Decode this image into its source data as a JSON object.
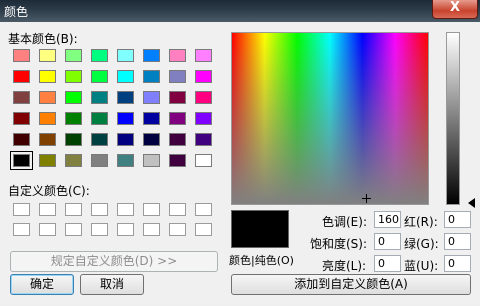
{
  "window": {
    "title": "颜色",
    "close_label": "X"
  },
  "basic_colors_label": "基本颜色(B):",
  "custom_colors_label": "自定义颜色(C):",
  "basic_colors": [
    [
      "#ff8080",
      "#ffff80",
      "#80ff80",
      "#00ff80",
      "#80ffff",
      "#0080ff",
      "#ff80c0",
      "#ff80ff"
    ],
    [
      "#ff0000",
      "#ffff00",
      "#80ff00",
      "#00ff40",
      "#00ffff",
      "#0080c0",
      "#8080c0",
      "#ff00ff"
    ],
    [
      "#804040",
      "#ff8040",
      "#00ff00",
      "#008080",
      "#004080",
      "#8080ff",
      "#800040",
      "#ff0080"
    ],
    [
      "#800000",
      "#ff8000",
      "#008000",
      "#008040",
      "#0000ff",
      "#0000a0",
      "#800080",
      "#8000ff"
    ],
    [
      "#400000",
      "#804000",
      "#004000",
      "#004040",
      "#000080",
      "#000040",
      "#400040",
      "#400080"
    ],
    [
      "#000000",
      "#808000",
      "#808040",
      "#808080",
      "#408080",
      "#c0c0c0",
      "#400040",
      "#ffffff"
    ]
  ],
  "selected_basic": "#000000",
  "define_custom_button": "规定自定义颜色(D) >>",
  "ok_button": "确定",
  "cancel_button": "取消",
  "color_solid_label": "颜色|纯色(O)",
  "hue": {
    "label": "色调(E):",
    "value": "160"
  },
  "sat": {
    "label": "饱和度(S):",
    "value": "0"
  },
  "lum": {
    "label": "亮度(L):",
    "value": "0"
  },
  "red": {
    "label": "红(R):",
    "value": "0"
  },
  "green": {
    "label": "绿(G):",
    "value": "0"
  },
  "blue": {
    "label": "蓝(U):",
    "value": "0"
  },
  "add_custom_button": "添加到自定义颜色(A)",
  "current_color": "#000000"
}
